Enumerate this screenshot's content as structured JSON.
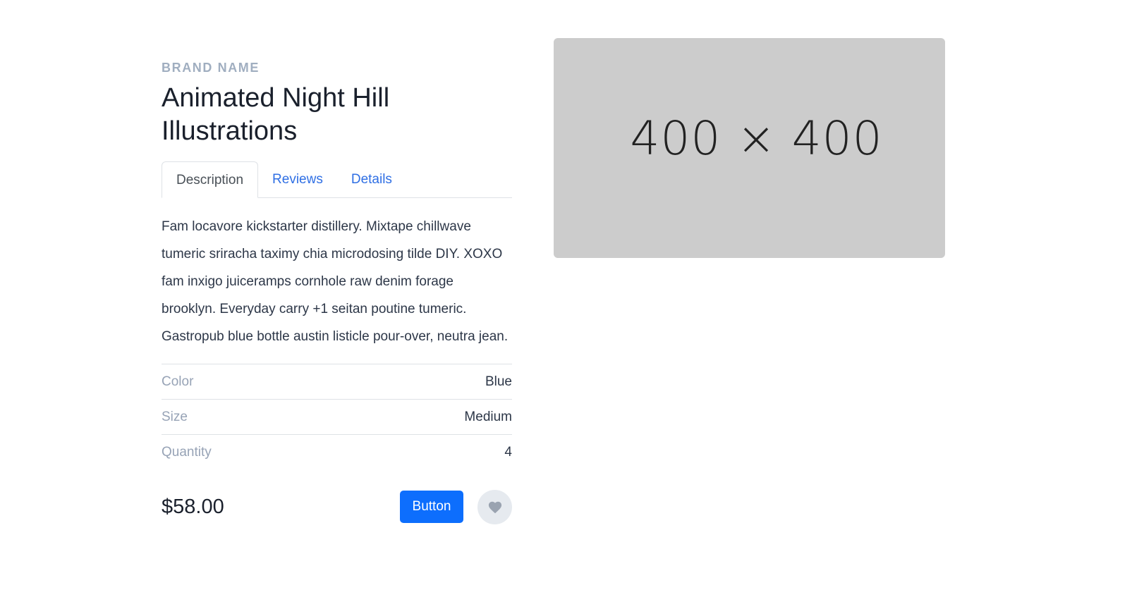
{
  "product": {
    "brand": "BRAND NAME",
    "title": "Animated Night Hill Illustrations",
    "tabs": [
      {
        "label": "Description",
        "active": true
      },
      {
        "label": "Reviews",
        "active": false
      },
      {
        "label": "Details",
        "active": false
      }
    ],
    "description": "Fam locavore kickstarter distillery. Mixtape chillwave tumeric sriracha taximy chia microdosing tilde DIY. XOXO fam inxigo juiceramps cornhole raw denim forage brooklyn. Everyday carry +1 seitan poutine tumeric. Gastropub blue bottle austin listicle pour-over, neutra jean.",
    "specs": [
      {
        "label": "Color",
        "value": "Blue"
      },
      {
        "label": "Size",
        "value": "Medium"
      },
      {
        "label": "Quantity",
        "value": "4"
      }
    ],
    "price": "$58.00",
    "button_label": "Button",
    "favorite_icon": "heart-icon"
  },
  "image": {
    "placeholder_text": "400 × 400",
    "background": "#cccccc"
  },
  "colors": {
    "accent": "#0d6efd",
    "link": "#2f6fe4",
    "muted": "#a0aec0"
  }
}
